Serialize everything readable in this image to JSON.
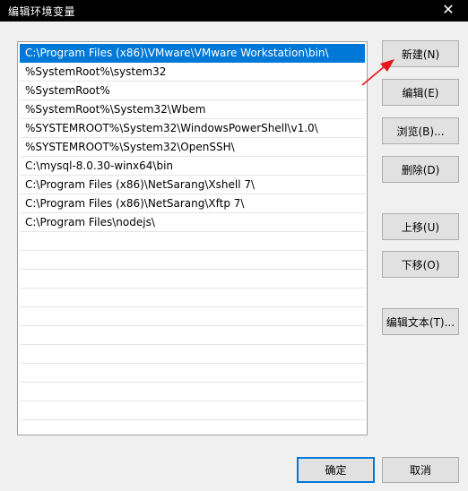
{
  "window": {
    "title": "编辑环境变量",
    "close_glyph": "✕"
  },
  "list": {
    "items": [
      "C:\\Program Files (x86)\\VMware\\VMware Workstation\\bin\\",
      "%SystemRoot%\\system32",
      "%SystemRoot%",
      "%SystemRoot%\\System32\\Wbem",
      "%SYSTEMROOT%\\System32\\WindowsPowerShell\\v1.0\\",
      "%SYSTEMROOT%\\System32\\OpenSSH\\",
      "C:\\mysql-8.0.30-winx64\\bin",
      "C:\\Program Files (x86)\\NetSarang\\Xshell 7\\",
      "C:\\Program Files (x86)\\NetSarang\\Xftp 7\\",
      "C:\\Program Files\\nodejs\\"
    ],
    "selected_index": 0,
    "total_rows": 21
  },
  "buttons": {
    "new": "新建(N)",
    "edit": "编辑(E)",
    "browse": "浏览(B)...",
    "delete": "删除(D)",
    "move_up": "上移(U)",
    "move_down": "下移(O)",
    "edit_text": "编辑文本(T)...",
    "ok": "确定",
    "cancel": "取消"
  },
  "colors": {
    "selection": "#0078d7",
    "annotation_arrow": "#e8131b"
  }
}
